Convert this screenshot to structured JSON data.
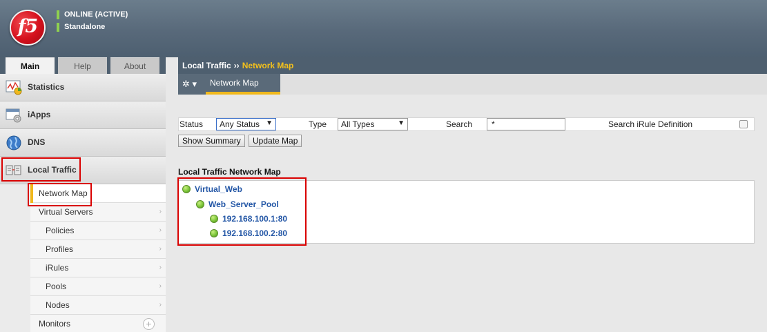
{
  "header": {
    "logo_text": "f5",
    "status_lines": [
      "ONLINE (ACTIVE)",
      "Standalone"
    ],
    "status_color": "#8fd14f"
  },
  "tabs": [
    {
      "label": "Main",
      "active": true
    },
    {
      "label": "Help",
      "active": false
    },
    {
      "label": "About",
      "active": false
    }
  ],
  "sidebar": {
    "sections": [
      {
        "label": "Statistics",
        "icon": "statistics-icon"
      },
      {
        "label": "iApps",
        "icon": "iapps-icon"
      },
      {
        "label": "DNS",
        "icon": "dns-globe-icon"
      },
      {
        "label": "Local Traffic",
        "icon": "local-traffic-icon"
      }
    ],
    "local_traffic_items": [
      {
        "label": "Network Map",
        "active": true,
        "chevron": false
      },
      {
        "label": "Virtual Servers",
        "chevron": true
      },
      {
        "label": "Policies",
        "chevron": true
      },
      {
        "label": "Profiles",
        "chevron": true
      },
      {
        "label": "iRules",
        "chevron": true
      },
      {
        "label": "Pools",
        "chevron": true
      },
      {
        "label": "Nodes",
        "chevron": true
      },
      {
        "label": "Monitors",
        "plus": true
      }
    ],
    "chevron_glyph": "›",
    "plus_glyph": "+"
  },
  "breadcrumb": {
    "parent": "Local Traffic",
    "separator": "››",
    "current": "Network Map"
  },
  "toolbar": {
    "gear_glyph": "✲ ▾",
    "subtab": "Network Map"
  },
  "filters": {
    "status_label": "Status",
    "status_value": "Any Status",
    "type_label": "Type",
    "type_value": "All Types",
    "search_label": "Search",
    "search_value": "*",
    "irule_label": "Search iRule Definition",
    "dropdown_arrow": "▼"
  },
  "buttons": {
    "show_summary": "Show Summary",
    "update_map": "Update Map"
  },
  "map": {
    "title": "Local Traffic Network Map",
    "virtual_server": "Virtual_Web",
    "pool": "Web_Server_Pool",
    "members": [
      "192.168.100.1:80",
      "192.168.100.2:80"
    ]
  },
  "colors": {
    "accent": "#f0b81c",
    "highlight": "#d90000",
    "link": "#2457a6"
  }
}
